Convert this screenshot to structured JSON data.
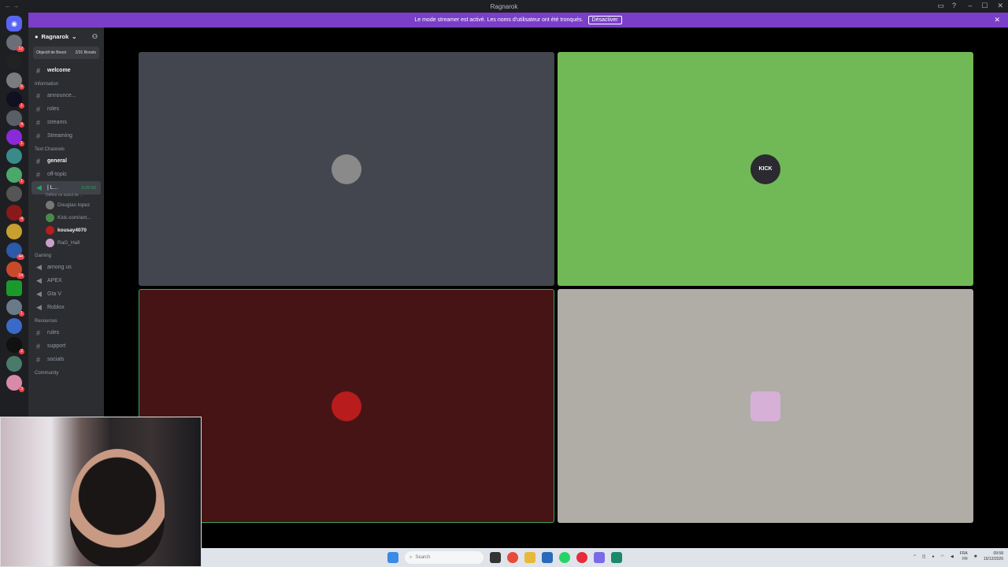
{
  "window": {
    "title": "Ragnarok",
    "controls": [
      "–",
      "☐",
      "✕"
    ]
  },
  "banner": {
    "text": "Le mode streamer est activé. Les noms d'utilisateur ont été tronqués.",
    "button": "Désactiver",
    "close": "✕"
  },
  "server": {
    "name": "Ragnarok",
    "boost_label": "Objectif de Boost",
    "boost_count": "2/31 Boosts"
  },
  "channels": {
    "welcome": "welcome",
    "cat_information": "Information",
    "announce": "announce...",
    "roles": "roles",
    "streams": "streams",
    "streaming": "Streaming",
    "cat_text": "Text Channels",
    "general": "general",
    "offtopic": "off-topic",
    "voice_name": "| L...",
    "voice_time": "5:25:50",
    "voice_status": "Définir un statut de ...",
    "cat_gaming": "Gaming",
    "among": "among us",
    "apex": "APEX",
    "gta": "Gta V",
    "roblox": "Roblox",
    "cat_resources": "Resources",
    "rules": "rules",
    "support": "support",
    "socials": "socials",
    "cat_community": "Community"
  },
  "voice_users": [
    "Douglas lopez",
    "Kick.com/ant...",
    "kousay4070",
    "RaG_Hafi"
  ],
  "tiles": [
    {
      "color": "#43464f",
      "avatar_color": "#8a8a8a",
      "label": ""
    },
    {
      "color": "#71b956",
      "avatar_color": "#2a2a30",
      "label": "KICK"
    },
    {
      "color": "#461414",
      "avatar_color": "#b81c1c",
      "label": ""
    },
    {
      "color": "#b0aca6",
      "avatar_color": "#d7b0d8",
      "label": ""
    }
  ],
  "taskbar": {
    "search_placeholder": "Search",
    "lang": "FRA",
    "lang2": "FR",
    "time": "09:58",
    "date": "15/12/2026"
  },
  "guild_badges": [
    "12",
    "",
    "",
    "6",
    "1",
    "4",
    "1",
    "",
    "1",
    "",
    "4",
    "",
    "44",
    "14",
    "",
    "1",
    "",
    "2",
    "",
    "3"
  ]
}
